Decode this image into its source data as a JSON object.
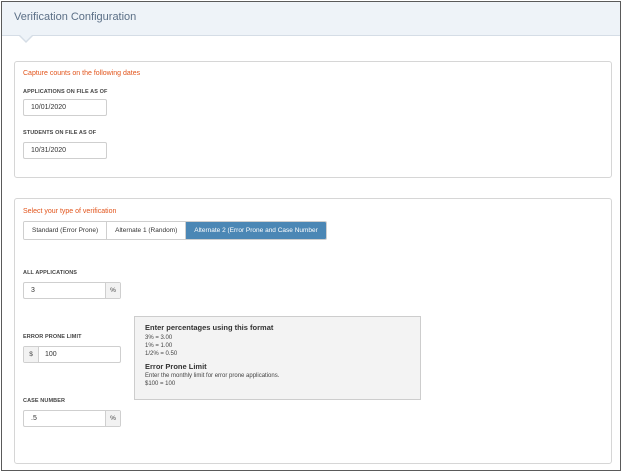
{
  "header": {
    "title": "Verification Configuration"
  },
  "capture": {
    "heading": "Capture counts on the following dates",
    "applications_label": "APPLICATIONS ON FILE AS OF",
    "applications_date": "10/01/2020",
    "students_label": "STUDENTS ON FILE AS OF",
    "students_date": "10/31/2020"
  },
  "verification": {
    "heading": "Select your type of verification",
    "tabs": [
      {
        "label": "Standard (Error Prone)"
      },
      {
        "label": "Alternate 1 (Random)"
      },
      {
        "label": "Alternate 2 (Error Prone and Case Number"
      }
    ],
    "selected_tab": 2,
    "all_applications_label": "ALL APPLICATIONS",
    "all_applications_value": "3",
    "percent_symbol": "%",
    "error_prone_label": "ERROR PRONE LIMIT",
    "dollar_symbol": "$",
    "error_prone_value": "100",
    "case_number_label": "CASE NUMBER",
    "case_number_value": ".5"
  },
  "help": {
    "title1": "Enter percentages using this format",
    "lines1": [
      "3% = 3.00",
      "1% = 1.00",
      "1/2% = 0.50"
    ],
    "title2": "Error Prone Limit",
    "lines2": [
      "Enter the monthly limit for error prone applications.",
      "$100 = 100"
    ]
  },
  "colors": {
    "accent_orange": "#e2541b",
    "tab_active": "#4b87b5",
    "header_bg": "#eef3f8"
  }
}
